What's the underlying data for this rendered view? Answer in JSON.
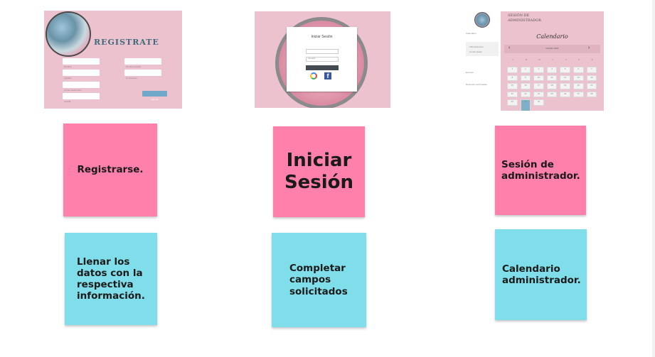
{
  "mockups": {
    "register": {
      "heading": "Registrate",
      "button_label": "Ingresar",
      "fields": [
        "Nombre",
        "Apellido",
        "Correo electrónico",
        "Celular",
        "Nombre usuario",
        "Contraseña"
      ]
    },
    "login": {
      "title": "Iniciar Sesión",
      "user_placeholder": "Usuario",
      "pass_placeholder": "Contraseña",
      "button_label": "Entrar"
    },
    "admin": {
      "session_title": "Sesión de administrador",
      "calendar_title": "Calendario",
      "month_label": "Octubre 2021",
      "sidebar_items": [
        "Calendario",
        "Administración",
        "Cerrar sesión",
        "Eventos",
        "Reservas confirmadas"
      ],
      "weekdays": [
        "L",
        "M",
        "M",
        "J",
        "V",
        "S",
        "D"
      ],
      "days": [
        "1",
        "2",
        "3",
        "4",
        "5",
        "6",
        "7",
        "8",
        "9",
        "10",
        "11",
        "12",
        "13",
        "14",
        "15",
        "16",
        "17",
        "18",
        "19",
        "20",
        "21",
        "22",
        "23",
        "24",
        "25",
        "26",
        "27",
        "28",
        "29",
        "30",
        "31"
      ]
    }
  },
  "notes": {
    "register_title": "Registrarse.",
    "register_desc": "Llenar los datos con la respectiva información.",
    "login_title": "Iniciar Sesión",
    "login_desc": "Completar campos solicitados",
    "admin_title": "Sesión de administrador.",
    "admin_desc": "Calendario administrador."
  },
  "colors": {
    "sticky_pink": "#ff80ab",
    "sticky_cyan": "#80deea",
    "mockup_pink": "#ebc2ce",
    "button_blue": "#6fa8c8"
  }
}
